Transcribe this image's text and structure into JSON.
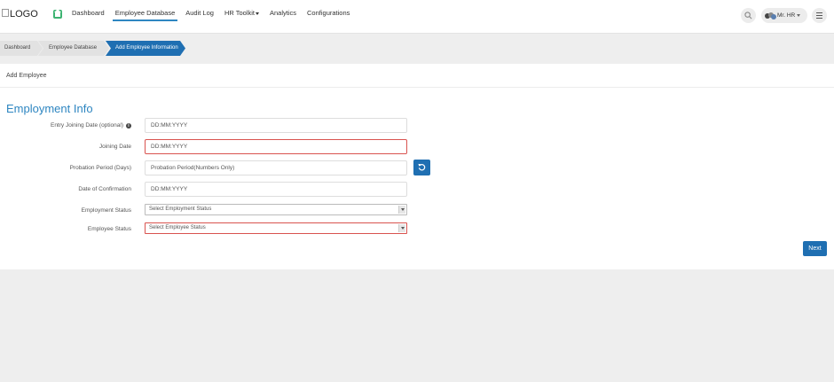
{
  "header": {
    "logo_alt": "LOGO",
    "nav": [
      {
        "label": "Dashboard",
        "active": false
      },
      {
        "label": "Employee Database",
        "active": true
      },
      {
        "label": "Audit Log",
        "active": false
      },
      {
        "label": "HR Toolkit",
        "active": false,
        "dropdown": true
      },
      {
        "label": "Analytics",
        "active": false
      },
      {
        "label": "Configurations",
        "active": false
      }
    ],
    "user_name": "Mr. HR"
  },
  "breadcrumb": [
    "Dashboard",
    "Employee Database",
    "Add Employee Information"
  ],
  "panel": {
    "header": "Add Employee",
    "section_title": "Employment Info",
    "fields": {
      "entry_joining_date": {
        "label": "Entry Joining Date (optional)",
        "placeholder": "DD:MM:YYYY"
      },
      "joining_date": {
        "label": "Joining Date",
        "placeholder": "DD:MM:YYYY"
      },
      "probation_period": {
        "label": "Probation Period (Days)",
        "placeholder": "Probation Period(Numbers Only)"
      },
      "date_of_confirmation": {
        "label": "Date of Confirmation",
        "placeholder": "DD:MM:YYYY"
      },
      "employment_status": {
        "label": "Employment Status",
        "selected": "Select Employment Status"
      },
      "employee_status": {
        "label": "Employee Status",
        "selected": "Select Employee Status"
      }
    },
    "next_label": "Next"
  },
  "colors": {
    "accent": "#2e86c1",
    "button": "#1f6fb2",
    "error_border": "#d9534f",
    "home_icon": "#3cb371"
  }
}
